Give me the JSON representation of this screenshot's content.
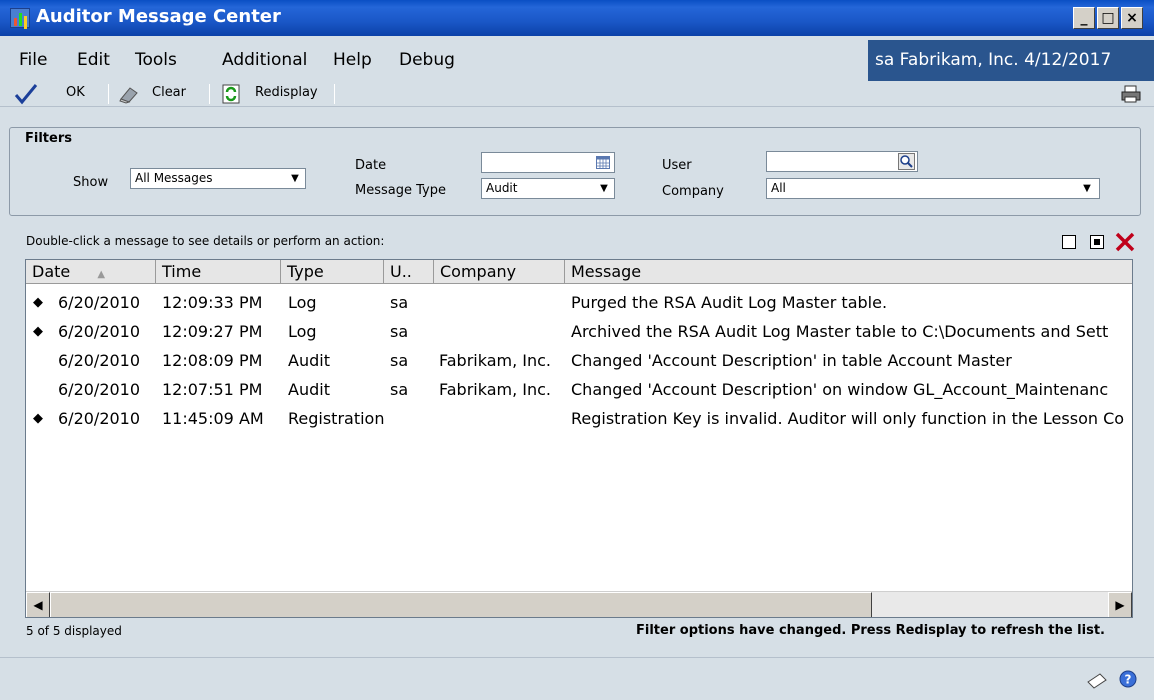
{
  "window": {
    "title": "Auditor Message Center",
    "min": "_",
    "max": "□",
    "close": "×"
  },
  "menu": {
    "items": [
      "File",
      "Edit",
      "Tools",
      "Additional",
      "Help",
      "Debug"
    ]
  },
  "user_info": "sa  Fabrikam, Inc. 4/12/2017",
  "toolbar": {
    "ok": "OK",
    "clear": "Clear",
    "redisplay": "Redisplay"
  },
  "filters": {
    "title": "Filters",
    "show_label": "Show",
    "show_value": "All Messages",
    "date_label": "Date",
    "date_value": "",
    "message_type_label": "Message Type",
    "message_type_value": "Audit",
    "user_label": "User",
    "user_value": "",
    "company_label": "Company",
    "company_value": "All"
  },
  "list": {
    "hint": "Double-click a message to see details or perform an action:",
    "columns": [
      "Date",
      "Time",
      "Type",
      "U..",
      "Company",
      "Message"
    ],
    "rows": [
      {
        "marker": true,
        "date": "6/20/2010",
        "time": "12:09:33 PM",
        "type": "Log",
        "user": "sa",
        "company": "",
        "message": "Purged the RSA Audit Log Master table."
      },
      {
        "marker": true,
        "date": "6/20/2010",
        "time": "12:09:27 PM",
        "type": "Log",
        "user": "sa",
        "company": "",
        "message": "Archived the RSA Audit Log Master table to C:\\Documents and Sett"
      },
      {
        "marker": false,
        "date": "6/20/2010",
        "time": "12:08:09 PM",
        "type": "Audit",
        "user": "sa",
        "company": "Fabrikam, Inc.",
        "message": "Changed 'Account Description' in table Account Master"
      },
      {
        "marker": false,
        "date": "6/20/2010",
        "time": "12:07:51 PM",
        "type": "Audit",
        "user": "sa",
        "company": "Fabrikam, Inc.",
        "message": "Changed 'Account Description' on window GL_Account_Maintenanc"
      },
      {
        "marker": true,
        "date": "6/20/2010",
        "time": "11:45:09 AM",
        "type": "Registration",
        "user": "",
        "company": "",
        "message": "Registration Key is invalid.  Auditor will only function in the Lesson Co"
      }
    ]
  },
  "status": {
    "count": "5 of 5 displayed",
    "message": "Filter options have changed.  Press Redisplay to refresh the list."
  },
  "colors": {
    "title_bar": "#1a57c7",
    "user_info_bg": "#2a558e",
    "window_bg": "#d6dfe6",
    "delete_red": "#c0001a"
  }
}
